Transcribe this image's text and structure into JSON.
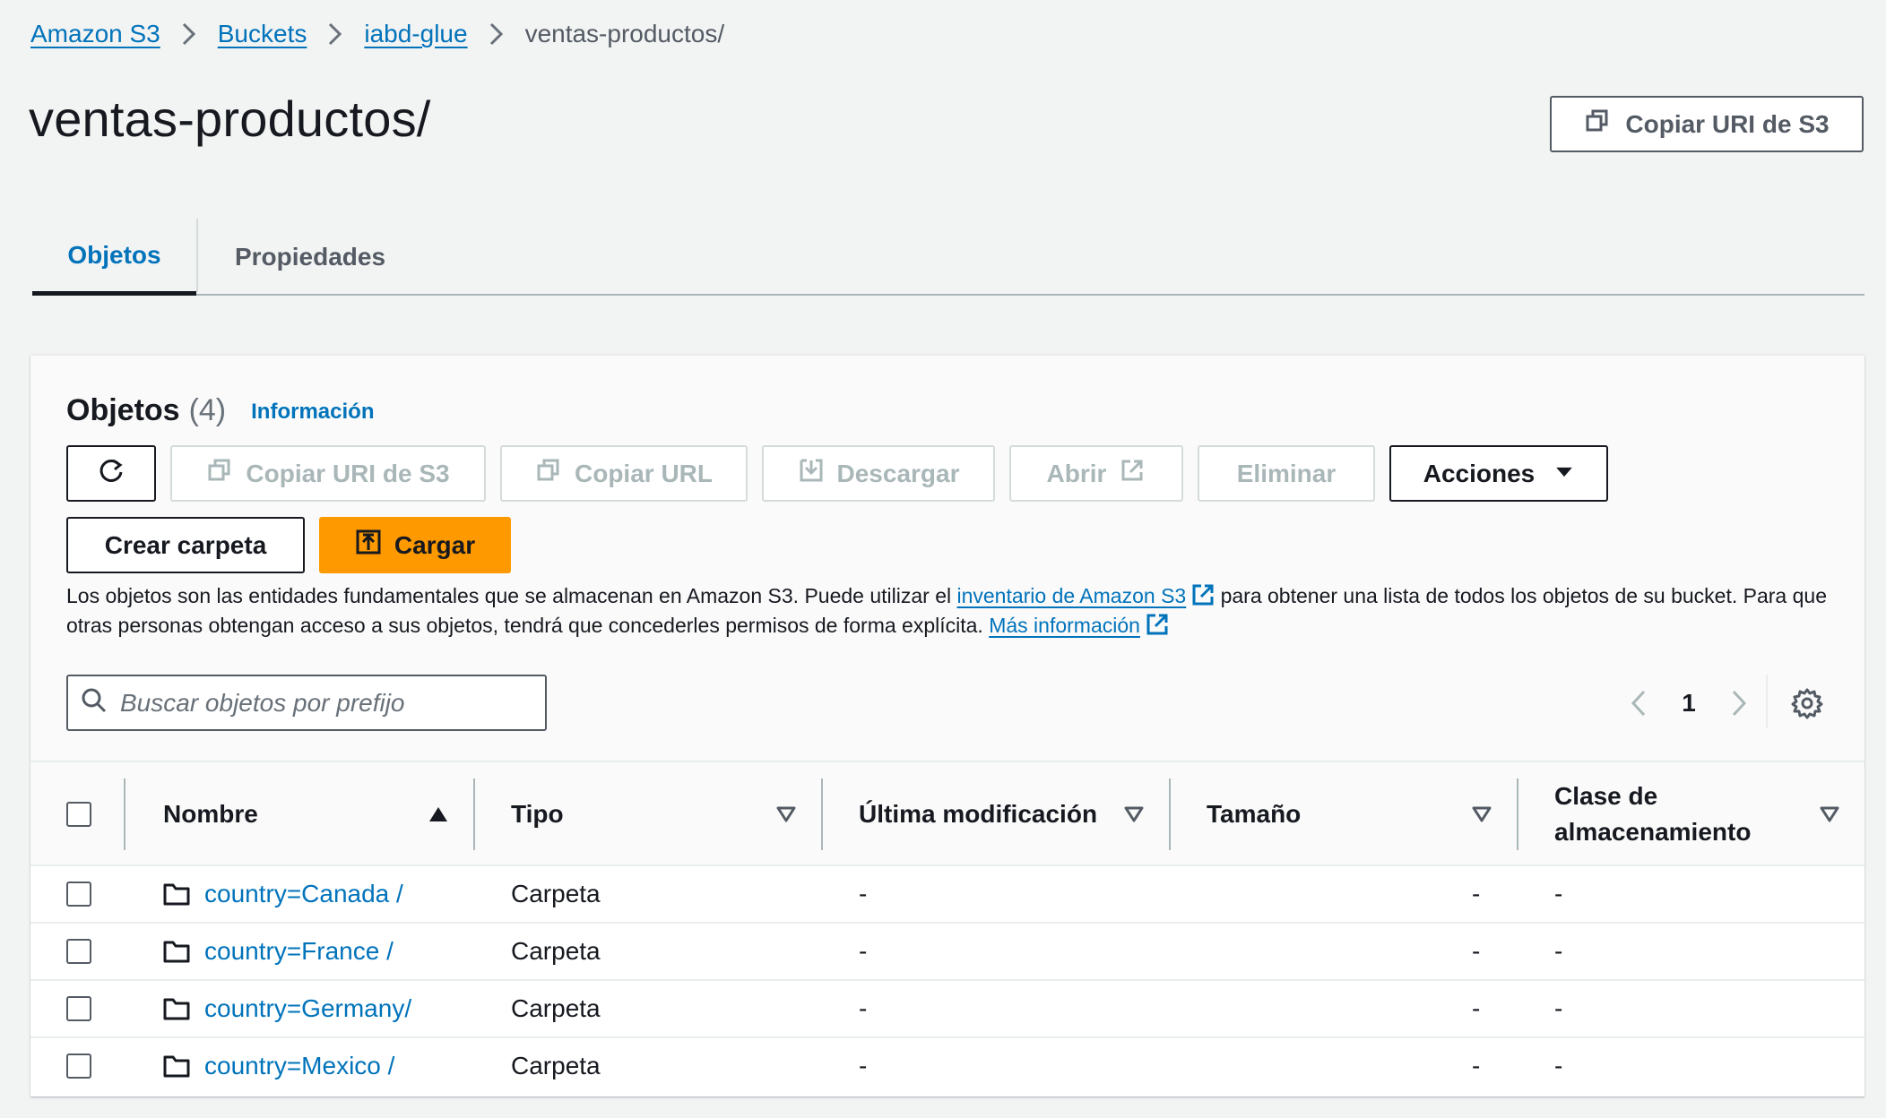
{
  "breadcrumb": {
    "items": [
      "Amazon S3",
      "Buckets",
      "iabd-glue"
    ],
    "current": "ventas-productos/"
  },
  "page": {
    "title": "ventas-productos/",
    "copy_uri_label": "Copiar URI de S3"
  },
  "tabs": [
    {
      "label": "Objetos",
      "active": true
    },
    {
      "label": "Propiedades",
      "active": false
    }
  ],
  "objects_panel": {
    "title": "Objetos",
    "count": "(4)",
    "info_link": "Información",
    "buttons": {
      "refresh": "refresh-icon",
      "copy_uri": "Copiar URI de S3",
      "copy_url": "Copiar URL",
      "download": "Descargar",
      "open": "Abrir",
      "delete": "Eliminar",
      "actions": "Acciones",
      "create_folder": "Crear carpeta",
      "upload": "Cargar"
    },
    "description": {
      "part1": "Los objetos son las entidades fundamentales que se almacenan en Amazon S3. Puede utilizar el ",
      "link1": "inventario de Amazon S3",
      "part2": " para obtener una lista de todos los objetos de su bucket. Para que otras personas obtengan acceso a sus objetos, tendrá que concederles permisos de forma explícita. ",
      "link2": "Más información"
    },
    "search": {
      "placeholder": "Buscar objetos por prefijo",
      "value": ""
    },
    "pagination": {
      "current_page": "1"
    }
  },
  "table": {
    "columns": [
      "Nombre",
      "Tipo",
      "Última modificación",
      "Tamaño",
      "Clase de almacenamiento"
    ],
    "column_class_line1": "Clase de",
    "column_class_line2": "almacenamiento",
    "rows": [
      {
        "name": "country=Canada /",
        "type": "Carpeta",
        "modified": "-",
        "size": "-",
        "storage_class": "-"
      },
      {
        "name": "country=France /",
        "type": "Carpeta",
        "modified": "-",
        "size": "-",
        "storage_class": "-"
      },
      {
        "name": "country=Germany/",
        "type": "Carpeta",
        "modified": "-",
        "size": "-",
        "storage_class": "-"
      },
      {
        "name": "country=Mexico /",
        "type": "Carpeta",
        "modified": "-",
        "size": "-",
        "storage_class": "-"
      }
    ]
  },
  "colors": {
    "link": "#0073bb",
    "primary_button": "#ff9900",
    "text": "#16191f",
    "disabled": "#aab7b8",
    "background": "#f2f3f3"
  }
}
